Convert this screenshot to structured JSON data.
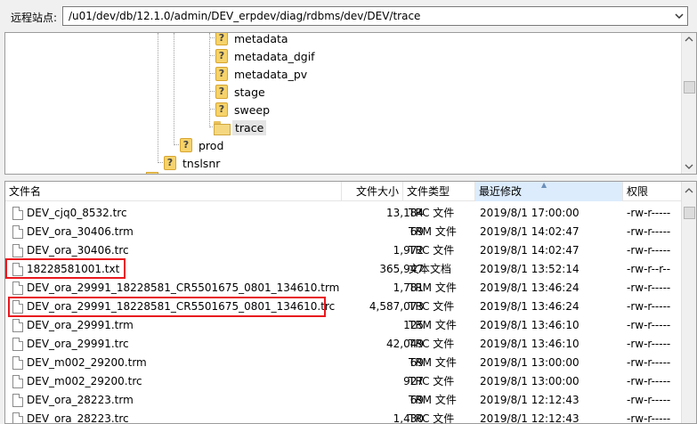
{
  "address": {
    "label": "远程站点:",
    "path": "/u01/dev/db/12.1.0/admin/DEV_erpdev/diag/rdbms/dev/DEV/trace"
  },
  "tree": {
    "nodes": [
      {
        "label": "metadata",
        "icon": "question-folder-icon"
      },
      {
        "label": "metadata_dgif",
        "icon": "question-folder-icon"
      },
      {
        "label": "metadata_pv",
        "icon": "question-folder-icon"
      },
      {
        "label": "stage",
        "icon": "question-folder-icon"
      },
      {
        "label": "sweep",
        "icon": "question-folder-icon"
      },
      {
        "label": "trace",
        "icon": "folder-icon"
      },
      {
        "label": "prod",
        "icon": "question-folder-icon"
      },
      {
        "label": "tnslsnr",
        "icon": "question-folder-icon"
      }
    ]
  },
  "list": {
    "columns": [
      "文件名",
      "文件大小",
      "文件类型",
      "最近修改",
      "权限"
    ],
    "sorted_column": "最近修改",
    "rows": [
      {
        "name": "DEV_cjq0_8532.trc",
        "size": "13,184",
        "type": "TRC 文件",
        "modified": "2019/8/1 17:00:00",
        "perms": "-rw-r-----"
      },
      {
        "name": "DEV_ora_30406.trm",
        "size": "69",
        "type": "TRM 文件",
        "modified": "2019/8/1 14:02:47",
        "perms": "-rw-r-----"
      },
      {
        "name": "DEV_ora_30406.trc",
        "size": "1,972",
        "type": "TRC 文件",
        "modified": "2019/8/1 14:02:47",
        "perms": "-rw-r-----"
      },
      {
        "name": "18228581001.txt",
        "size": "365,947",
        "type": "文本文档",
        "modified": "2019/8/1 13:52:14",
        "perms": "-rw-r--r--"
      },
      {
        "name": "DEV_ora_29991_18228581_CR5501675_0801_134610.trm",
        "size": "1,781",
        "type": "TRM 文件",
        "modified": "2019/8/1 13:46:24",
        "perms": "-rw-r-----"
      },
      {
        "name": "DEV_ora_29991_18228581_CR5501675_0801_134610.trc",
        "size": "4,587,073",
        "type": "TRC 文件",
        "modified": "2019/8/1 13:46:24",
        "perms": "-rw-r-----"
      },
      {
        "name": "DEV_ora_29991.trm",
        "size": "125",
        "type": "TRM 文件",
        "modified": "2019/8/1 13:46:10",
        "perms": "-rw-r-----"
      },
      {
        "name": "DEV_ora_29991.trc",
        "size": "42,049",
        "type": "TRC 文件",
        "modified": "2019/8/1 13:46:10",
        "perms": "-rw-r-----"
      },
      {
        "name": "DEV_m002_29200.trm",
        "size": "69",
        "type": "TRM 文件",
        "modified": "2019/8/1 13:00:00",
        "perms": "-rw-r-----"
      },
      {
        "name": "DEV_m002_29200.trc",
        "size": "927",
        "type": "TRC 文件",
        "modified": "2019/8/1 13:00:00",
        "perms": "-rw-r-----"
      },
      {
        "name": "DEV_ora_28223.trm",
        "size": "69",
        "type": "TRM 文件",
        "modified": "2019/8/1 12:12:43",
        "perms": "-rw-r-----"
      },
      {
        "name": "DEV_ora_28223.trc",
        "size": "1,430",
        "type": "TRC 文件",
        "modified": "2019/8/1 12:12:43",
        "perms": "-rw-r-----"
      }
    ]
  },
  "colors": {
    "highlight": "#e8191f",
    "sorted_header": "#dcecfc"
  }
}
